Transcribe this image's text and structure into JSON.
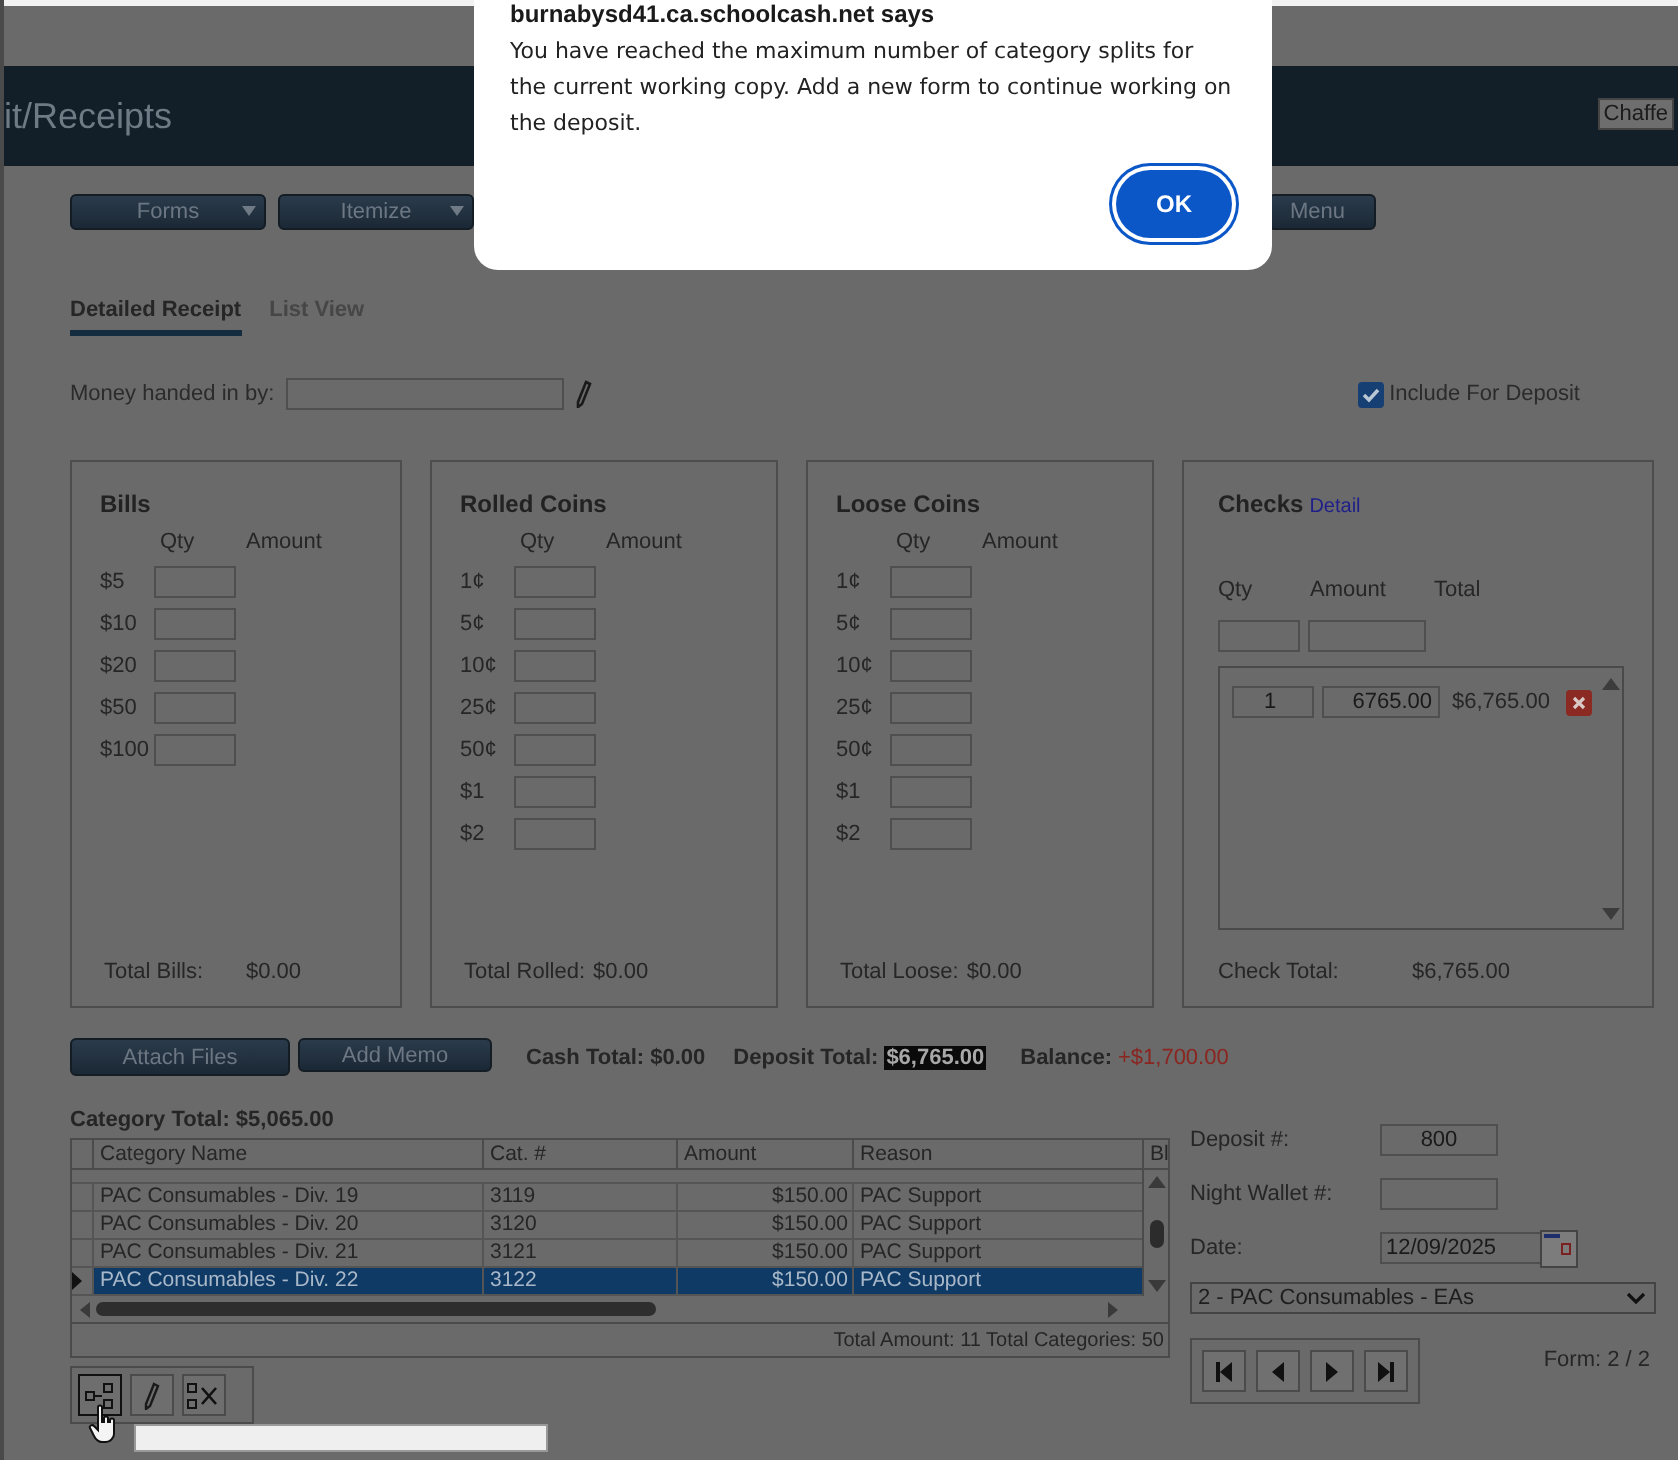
{
  "header": {
    "title": "it/Receipts",
    "user_select": "Chaffe"
  },
  "toolbar": [
    {
      "label": "Forms",
      "dropdown": true
    },
    {
      "label": "Itemize",
      "dropdown": true
    },
    {
      "label": "Menu",
      "dropdown": false
    }
  ],
  "tabs": [
    {
      "label": "Detailed Receipt",
      "selected": true
    },
    {
      "label": "List View",
      "selected": false
    }
  ],
  "money_handed_in": {
    "label": "Money handed in by:"
  },
  "include_for_deposit": {
    "label": "Include For Deposit",
    "checked": true
  },
  "panels": [
    {
      "kind": "denominations",
      "title": "Bills",
      "qty_header": "Qty",
      "amount_header": "Amount",
      "rows": [
        "$5",
        "$10",
        "$20",
        "$50",
        "$100"
      ],
      "total_label": "Total Bills:",
      "total": "$0.00"
    },
    {
      "kind": "denominations",
      "title": "Rolled Coins",
      "qty_header": "Qty",
      "amount_header": "Amount",
      "rows": [
        "1¢",
        "5¢",
        "10¢",
        "25¢",
        "50¢",
        "$1",
        "$2"
      ],
      "total_label": "Total Rolled:",
      "total": "$0.00"
    },
    {
      "kind": "denominations",
      "title": "Loose Coins",
      "qty_header": "Qty",
      "amount_header": "Amount",
      "rows": [
        "1¢",
        "5¢",
        "10¢",
        "25¢",
        "50¢",
        "$1",
        "$2"
      ],
      "total_label": "Total Loose:",
      "total": "$0.00"
    },
    {
      "kind": "checks",
      "title": "Checks",
      "link": "Detail",
      "headers": [
        "Qty",
        "Amount",
        "Total"
      ],
      "entries": [
        {
          "qty": "1",
          "amount": "6765.00",
          "total": "$6,765.00"
        }
      ],
      "total_label": "Check Total:",
      "total": "$6,765.00"
    }
  ],
  "actions": {
    "buttons": [
      "Attach Files",
      "Add Memo"
    ],
    "cash_total": "Cash Total: $0.00",
    "deposit_total_label": "Deposit Total:",
    "deposit_total": "$6,765.00",
    "balance_label": "Balance:",
    "balance": "+$1,700.00"
  },
  "category_total": "Category Total: $5,065.00",
  "table": {
    "columns": [
      "Category Name",
      "Cat. #",
      "Amount",
      "Reason",
      "Bl"
    ],
    "rows": [
      {
        "cells": [
          "PAC Consumables - Div. 19",
          "3119",
          "$150.00",
          "PAC Support"
        ],
        "selected": false
      },
      {
        "cells": [
          "PAC Consumables - Div. 20",
          "3120",
          "$150.00",
          "PAC Support"
        ],
        "selected": false
      },
      {
        "cells": [
          "PAC Consumables - Div. 21",
          "3121",
          "$150.00",
          "PAC Support"
        ],
        "selected": false
      },
      {
        "cells": [
          "PAC Consumables - Div. 22",
          "3122",
          "$150.00",
          "PAC Support"
        ],
        "selected": true
      }
    ],
    "footer": "Total Amount: 11 Total Categories: 50"
  },
  "deposit_fields": [
    {
      "label": "Deposit #:",
      "value": "800",
      "kind": "text"
    },
    {
      "label": "Night Wallet #:",
      "kind": "text"
    },
    {
      "label": "Date:",
      "value": "12/09/2025",
      "kind": "date"
    }
  ],
  "form_select": "2 - PAC Consumables - EAs",
  "form_counter": "Form: 2 / 2",
  "dialog": {
    "title": "burnabysd41.ca.schoolcash.net says",
    "message": "You have reached the maximum number of category splits for the current working copy. Add a new form to continue working on the deposit.",
    "button": "OK"
  }
}
